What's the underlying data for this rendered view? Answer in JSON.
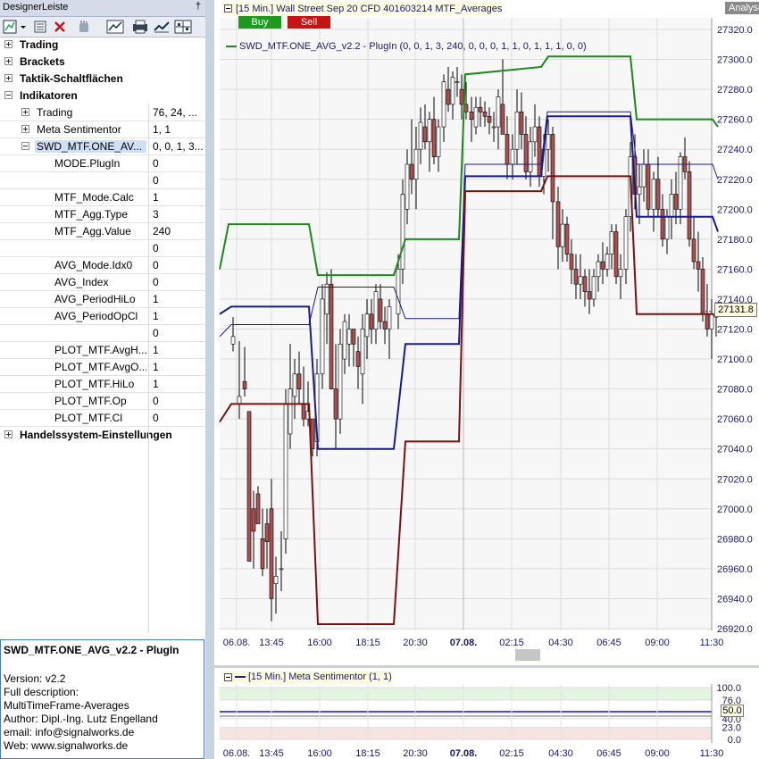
{
  "panel": {
    "title": "DesignerLeiste",
    "pin": "†"
  },
  "tree": {
    "sections": [
      "Trading",
      "Brackets",
      "Taktik-Schaltflächen",
      "Indikatoren"
    ],
    "indicators": [
      {
        "label": "Trading",
        "value": "76, 24, ..."
      },
      {
        "label": "Meta Sentimentor",
        "value": "1, 1"
      },
      {
        "label": "SWD_MTF.ONE_AV...",
        "value": "0, 0, 1, 3..."
      }
    ],
    "params": [
      {
        "label": "MODE.PlugIn",
        "value": "0"
      },
      {
        "label": "",
        "value": "0"
      },
      {
        "label": "MTF_Mode.Calc",
        "value": "1"
      },
      {
        "label": "MTF_Agg.Type",
        "value": "3"
      },
      {
        "label": "MTF_Agg.Value",
        "value": "240"
      },
      {
        "label": "",
        "value": "0"
      },
      {
        "label": "AVG_Mode.Idx0",
        "value": "0"
      },
      {
        "label": "AVG_Index",
        "value": "0"
      },
      {
        "label": "AVG_PeriodHiLo",
        "value": "1"
      },
      {
        "label": "AVG_PeriodOpCl",
        "value": "1"
      },
      {
        "label": "",
        "value": "0"
      },
      {
        "label": "PLOT_MTF.AvgH...",
        "value": "1"
      },
      {
        "label": "PLOT_MTF.AvgO...",
        "value": "1"
      },
      {
        "label": "PLOT_MTF.HiLo",
        "value": "1"
      },
      {
        "label": "PLOT_MTF.Op",
        "value": "0"
      },
      {
        "label": "PLOT_MTF.Cl",
        "value": "0"
      }
    ],
    "last_section": "Handelssystem-Einstellungen"
  },
  "description": {
    "title": "SWD_MTF.ONE_AVG_v2.2 - PlugIn",
    "lines": [
      "Version: v2.2",
      "Full description:",
      "MultiTimeFrame-Averages",
      "Author: Dipl.-Ing. Lutz Engelland",
      "email: info@signalworks.de",
      "Web: www.signalworks.de"
    ]
  },
  "chart": {
    "header": "[15 Min.] Wall Street Sep 20 CFD   401603214 MTF_Averages",
    "analysen": "Analysen",
    "buy": "Buy",
    "sell": "Sell",
    "legend": "SWD_MTF.ONE_AVG_v2.2 - PlugIn  (0, 0, 1, 3, 240, 0, 0, 0, 1, 1, 0, 1, 1, 1, 0, 0)",
    "last_price": "27131.8",
    "colors": {
      "green": "#1a8a1a",
      "blue": "#1a1a8a",
      "red": "#7a1010",
      "candle_body": "#b05050"
    }
  },
  "chart_data": {
    "type": "line",
    "yticks": [
      "27320.0",
      "27300.0",
      "27280.0",
      "27260.0",
      "27240.0",
      "27220.0",
      "27200.0",
      "27180.0",
      "27160.0",
      "27140.0",
      "27120.0",
      "27100.0",
      "27080.0",
      "27060.0",
      "27040.0",
      "27020.0",
      "27000.0",
      "26980.0",
      "26960.0",
      "26940.0",
      "26920.0"
    ],
    "xticks": [
      "06.08.",
      "13:45",
      "16:00",
      "18:15",
      "20:30",
      "07.08.",
      "02:15",
      "04:30",
      "06:45",
      "09:00",
      "11:30"
    ],
    "ylim": [
      26920,
      27320
    ],
    "series": [
      {
        "name": "green",
        "points": [
          [
            0,
            27160
          ],
          [
            10,
            27190
          ],
          [
            100,
            27190
          ],
          [
            110,
            27156
          ],
          [
            195,
            27156
          ],
          [
            208,
            27180
          ],
          [
            268,
            27180
          ],
          [
            275,
            27290
          ],
          [
            360,
            27295
          ],
          [
            368,
            27302
          ],
          [
            460,
            27302
          ],
          [
            467,
            27260
          ],
          [
            552,
            27260
          ],
          [
            558,
            27255
          ]
        ]
      },
      {
        "name": "blue",
        "points": [
          [
            0,
            27130
          ],
          [
            13,
            27135
          ],
          [
            100,
            27135
          ],
          [
            110,
            27040
          ],
          [
            195,
            27040
          ],
          [
            208,
            27110
          ],
          [
            268,
            27110
          ],
          [
            275,
            27222
          ],
          [
            360,
            27222
          ],
          [
            367,
            27262
          ],
          [
            460,
            27262
          ],
          [
            467,
            27195
          ],
          [
            552,
            27195
          ],
          [
            558,
            27185
          ]
        ]
      },
      {
        "name": "blue-thin",
        "points": [
          [
            0,
            27115
          ],
          [
            13,
            27123
          ],
          [
            100,
            27123
          ],
          [
            110,
            27148
          ],
          [
            195,
            27148
          ],
          [
            208,
            27127
          ],
          [
            268,
            27127
          ],
          [
            275,
            27230
          ],
          [
            360,
            27230
          ],
          [
            367,
            27265
          ],
          [
            460,
            27265
          ],
          [
            467,
            27230
          ],
          [
            552,
            27230
          ],
          [
            558,
            27220
          ]
        ]
      },
      {
        "name": "red",
        "points": [
          [
            0,
            27058
          ],
          [
            13,
            27070
          ],
          [
            100,
            27070
          ],
          [
            110,
            26923
          ],
          [
            195,
            26923
          ],
          [
            208,
            27045
          ],
          [
            268,
            27045
          ],
          [
            275,
            27212
          ],
          [
            360,
            27212
          ],
          [
            367,
            27222
          ],
          [
            460,
            27222
          ],
          [
            467,
            27130
          ],
          [
            552,
            27130
          ],
          [
            558,
            27128
          ]
        ]
      }
    ],
    "candles": [
      [
        15,
        27110,
        27128,
        27105,
        27115
      ],
      [
        22,
        27070,
        27112,
        27060,
        27075
      ],
      [
        28,
        27085,
        27108,
        27075,
        27080
      ],
      [
        33,
        27065,
        27062,
        26980,
        26965
      ],
      [
        38,
        27000,
        27012,
        26960,
        26985
      ],
      [
        43,
        27010,
        27015,
        26995,
        26990
      ],
      [
        48,
        26980,
        27000,
        26955,
        26960
      ],
      [
        53,
        26990,
        27000,
        26960,
        26978
      ],
      [
        58,
        27000,
        27020,
        26925,
        26940
      ],
      [
        63,
        26950,
        26968,
        26930,
        26955
      ],
      [
        69,
        26960,
        26985,
        26945,
        26960
      ],
      [
        74,
        26980,
        27080,
        26970,
        27070
      ],
      [
        79,
        27050,
        27110,
        27040,
        27080
      ],
      [
        84,
        27075,
        27100,
        27060,
        27090
      ],
      [
        89,
        27090,
        27105,
        27070,
        27080
      ],
      [
        94,
        27070,
        27095,
        27055,
        27060
      ],
      [
        99,
        27060,
        27085,
        27055,
        27065
      ],
      [
        104,
        27060,
        27058,
        27035,
        27040
      ],
      [
        109,
        27045,
        27100,
        27035,
        27090
      ],
      [
        115,
        27090,
        27150,
        27080,
        27140
      ],
      [
        120,
        27130,
        27158,
        27110,
        27150
      ],
      [
        125,
        27150,
        27160,
        27090,
        27080
      ],
      [
        130,
        27080,
        27110,
        27040,
        27060
      ],
      [
        135,
        27060,
        27120,
        27050,
        27110
      ],
      [
        140,
        27100,
        27130,
        27090,
        27125
      ],
      [
        145,
        27110,
        27130,
        27095,
        27120
      ],
      [
        150,
        27120,
        27118,
        27095,
        27110
      ],
      [
        155,
        27105,
        27115,
        27080,
        27095
      ],
      [
        160,
        27090,
        27130,
        27070,
        27120
      ],
      [
        165,
        27115,
        27140,
        27100,
        27130
      ],
      [
        170,
        27130,
        27140,
        27110,
        27120
      ],
      [
        175,
        27120,
        27150,
        27110,
        27145
      ],
      [
        180,
        27140,
        27150,
        27120,
        27125
      ],
      [
        185,
        27125,
        27135,
        27110,
        27120
      ],
      [
        190,
        27120,
        27140,
        27100,
        27135
      ],
      [
        200,
        27130,
        27170,
        27120,
        27160
      ],
      [
        205,
        27160,
        27220,
        27150,
        27210
      ],
      [
        210,
        27200,
        27240,
        27190,
        27230
      ],
      [
        215,
        27230,
        27260,
        27210,
        27220
      ],
      [
        220,
        27220,
        27255,
        27200,
        27240
      ],
      [
        225,
        27240,
        27268,
        27230,
        27258
      ],
      [
        230,
        27255,
        27270,
        27240,
        27245
      ],
      [
        235,
        27245,
        27265,
        27225,
        27260
      ],
      [
        240,
        27260,
        27275,
        27230,
        27235
      ],
      [
        245,
        27235,
        27260,
        27225,
        27255
      ],
      [
        251,
        27255,
        27290,
        27245,
        27285
      ],
      [
        256,
        27280,
        27295,
        27265,
        27270
      ],
      [
        261,
        27270,
        27292,
        27260,
        27288
      ],
      [
        266,
        27285,
        27295,
        27275,
        27285
      ],
      [
        271,
        27280,
        27290,
        27260,
        27270
      ],
      [
        276,
        27270,
        27285,
        27260,
        27265
      ],
      [
        282,
        27265,
        27275,
        27245,
        27260
      ],
      [
        287,
        27255,
        27275,
        27250,
        27268
      ],
      [
        292,
        27268,
        27275,
        27255,
        27265
      ],
      [
        297,
        27265,
        27272,
        27255,
        27262
      ],
      [
        302,
        27262,
        27268,
        27250,
        27258
      ],
      [
        307,
        27255,
        27265,
        27245,
        27255
      ],
      [
        312,
        27255,
        27280,
        27240,
        27275
      ],
      [
        317,
        27270,
        27300,
        27255,
        27250
      ],
      [
        322,
        27250,
        27262,
        27220,
        27230
      ],
      [
        328,
        27230,
        27250,
        27220,
        27240
      ],
      [
        333,
        27240,
        27280,
        27230,
        27265
      ],
      [
        338,
        27265,
        27278,
        27240,
        27250
      ],
      [
        343,
        27250,
        27262,
        27220,
        27225
      ],
      [
        348,
        27225,
        27255,
        27215,
        27245
      ],
      [
        353,
        27245,
        27270,
        27235,
        27255
      ],
      [
        358,
        27255,
        27262,
        27215,
        27222
      ],
      [
        363,
        27222,
        27250,
        27210,
        27240
      ],
      [
        368,
        27240,
        27260,
        27225,
        27250
      ],
      [
        373,
        27250,
        27255,
        27180,
        27205
      ],
      [
        379,
        27205,
        27215,
        27160,
        27175
      ],
      [
        384,
        27175,
        27200,
        27165,
        27190
      ],
      [
        389,
        27190,
        27195,
        27165,
        27170
      ],
      [
        394,
        27170,
        27180,
        27150,
        27160
      ],
      [
        399,
        27160,
        27170,
        27140,
        27150
      ],
      [
        404,
        27150,
        27170,
        27140,
        27155
      ],
      [
        409,
        27155,
        27160,
        27135,
        27145
      ],
      [
        414,
        27145,
        27160,
        27130,
        27140
      ],
      [
        419,
        27140,
        27160,
        27135,
        27155
      ],
      [
        424,
        27155,
        27170,
        27145,
        27165
      ],
      [
        429,
        27165,
        27178,
        27150,
        27160
      ],
      [
        434,
        27160,
        27175,
        27155,
        27170
      ],
      [
        439,
        27170,
        27190,
        27160,
        27185
      ],
      [
        444,
        27185,
        27190,
        27150,
        27155
      ],
      [
        449,
        27155,
        27170,
        27140,
        27160
      ],
      [
        455,
        27160,
        27200,
        27150,
        27195
      ],
      [
        460,
        27195,
        27245,
        27185,
        27235
      ],
      [
        465,
        27235,
        27250,
        27200,
        27210
      ],
      [
        470,
        27210,
        27230,
        27190,
        27215
      ],
      [
        475,
        27215,
        27240,
        27205,
        27230
      ],
      [
        480,
        27230,
        27240,
        27195,
        27200
      ],
      [
        486,
        27200,
        27225,
        27185,
        27220
      ],
      [
        491,
        27220,
        27235,
        27195,
        27200
      ],
      [
        496,
        27200,
        27210,
        27175,
        27180
      ],
      [
        501,
        27180,
        27200,
        27170,
        27195
      ],
      [
        506,
        27195,
        27220,
        27180,
        27210
      ],
      [
        511,
        27210,
        27225,
        27190,
        27200
      ],
      [
        516,
        27200,
        27238,
        27190,
        27235
      ],
      [
        521,
        27235,
        27248,
        27220,
        27225
      ],
      [
        526,
        27225,
        27232,
        27175,
        27180
      ],
      [
        531,
        27180,
        27195,
        27160,
        27165
      ],
      [
        536,
        27165,
        27185,
        27145,
        27160
      ],
      [
        541,
        27160,
        27168,
        27125,
        27130
      ],
      [
        546,
        27130,
        27150,
        27115,
        27120
      ],
      [
        551,
        27120,
        27140,
        27100,
        27130
      ],
      [
        556,
        27130,
        27138,
        27115,
        27128
      ]
    ]
  },
  "subchart": {
    "header": "[15 Min.] Meta Sentimentor  (1, 1)",
    "value": "50.0",
    "yticks": [
      "100.0",
      "76.0",
      "50.0",
      "40.0",
      "23.0",
      "0.0"
    ]
  }
}
